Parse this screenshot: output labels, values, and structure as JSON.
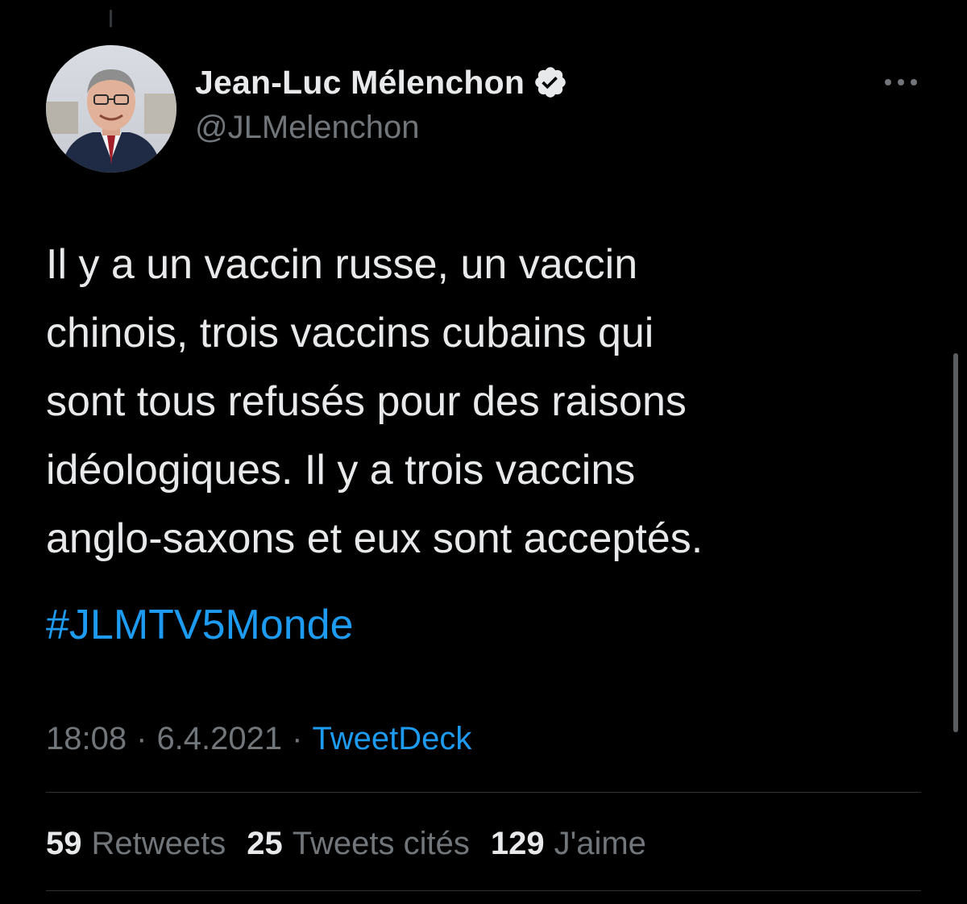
{
  "author": {
    "display_name": "Jean-Luc Mélenchon",
    "handle": "@JLMelenchon",
    "verified": true
  },
  "tweet": {
    "text": "Il y a un vaccin russe, un vaccin\nchinois, trois vaccins cubains qui\nsont tous refusés pour des raisons\nidéologiques. Il y a trois vaccins\nanglo-saxons et eux sont acceptés.",
    "hashtag": "#JLMTV5Monde"
  },
  "meta": {
    "time": "18:08",
    "separator": "·",
    "date": "6.4.2021",
    "source": "TweetDeck"
  },
  "stats": {
    "retweets_count": "59",
    "retweets_label": "Retweets",
    "quotes_count": "25",
    "quotes_label": "Tweets cités",
    "likes_count": "129",
    "likes_label": "J'aime"
  },
  "colors": {
    "background": "#000000",
    "primary_text": "#e7e9ea",
    "secondary_text": "#71767b",
    "accent": "#1d9bf0",
    "divider": "#2f3336"
  },
  "icons": {
    "verified": "verified-badge-icon",
    "more": "more-horizontal-icon"
  }
}
